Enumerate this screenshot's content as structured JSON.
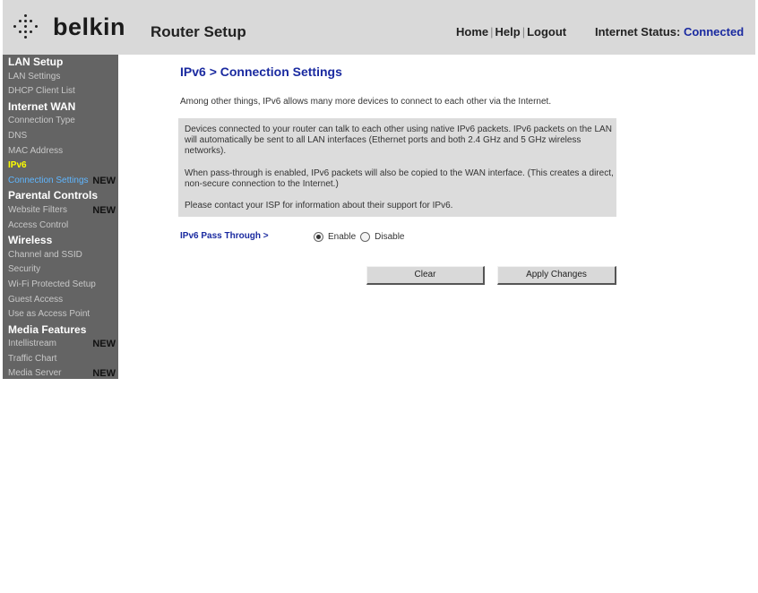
{
  "header": {
    "logo_text": "belkin",
    "title": "Router Setup",
    "nav": {
      "home": "Home",
      "help": "Help",
      "logout": "Logout",
      "sep": "|"
    },
    "status_label": "Internet Status:",
    "status_value": "Connected"
  },
  "sidebar": {
    "items": [
      {
        "label": "LAN Setup",
        "type": "heading"
      },
      {
        "label": "LAN Settings",
        "type": "link"
      },
      {
        "label": "DHCP Client List",
        "type": "link"
      },
      {
        "label": "Internet WAN",
        "type": "heading"
      },
      {
        "label": "Connection Type",
        "type": "link"
      },
      {
        "label": "DNS",
        "type": "link"
      },
      {
        "label": "MAC Address",
        "type": "link"
      },
      {
        "label": "IPv6",
        "type": "active"
      },
      {
        "label": "Connection Settings",
        "type": "sub-active",
        "badge": "NEW"
      },
      {
        "label": "Parental Controls",
        "type": "heading"
      },
      {
        "label": "Website Filters",
        "type": "link",
        "badge": "NEW"
      },
      {
        "label": "Access Control",
        "type": "link"
      },
      {
        "label": "Wireless",
        "type": "heading"
      },
      {
        "label": "Channel and SSID",
        "type": "link"
      },
      {
        "label": "Security",
        "type": "link"
      },
      {
        "label": "Wi-Fi Protected Setup",
        "type": "link"
      },
      {
        "label": "Guest Access",
        "type": "link"
      },
      {
        "label": "Use as Access Point",
        "type": "link"
      },
      {
        "label": "Media Features",
        "type": "heading"
      },
      {
        "label": "Intellistream",
        "type": "link",
        "badge": "NEW"
      },
      {
        "label": "Traffic Chart",
        "type": "link"
      },
      {
        "label": "Media Server",
        "type": "link",
        "badge": "NEW"
      }
    ]
  },
  "main": {
    "title": "IPv6 > Connection Settings",
    "intro": "Among other things, IPv6 allows many more devices to connect to each other via the Internet.",
    "info": {
      "p1": "Devices connected to your router can talk to each other using native IPv6 packets. IPv6 packets on the LAN will automatically be sent to all LAN interfaces (Ethernet ports and both 2.4 GHz and 5 GHz wireless networks).",
      "p2": "When pass-through is enabled, IPv6 packets will also be copied to the WAN interface. (This creates a direct, non-secure connection to the Internet.)",
      "p3": "Please contact your ISP for information about their support for IPv6."
    },
    "pass_through": {
      "label": "IPv6 Pass Through >",
      "enable_label": "Enable",
      "disable_label": "Disable",
      "selected": "Enable"
    },
    "buttons": {
      "clear": "Clear",
      "apply": "Apply Changes"
    }
  }
}
